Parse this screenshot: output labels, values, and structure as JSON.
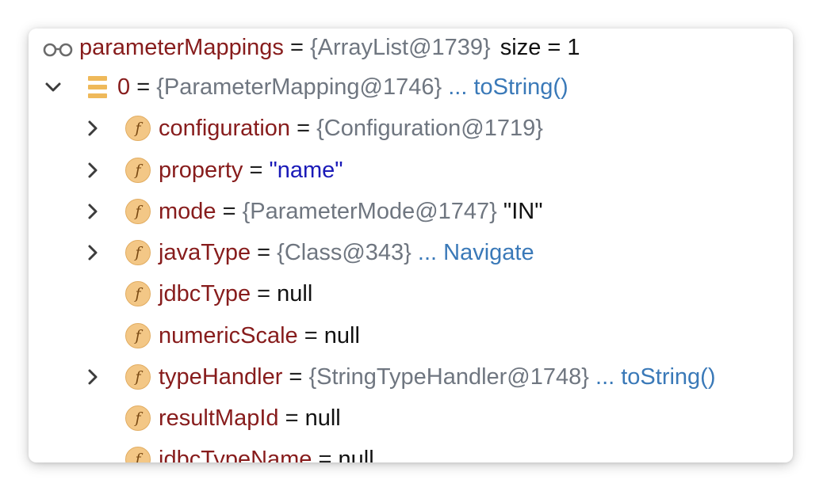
{
  "root": {
    "name": "parameterMappings",
    "eq": " = ",
    "obj": "{ArrayList@1739}",
    "extra": "size = 1"
  },
  "item0": {
    "name": "0",
    "eq": " = ",
    "obj": "{ParameterMapping@1746}",
    "link": "... toString()"
  },
  "fields": [
    {
      "name": "configuration",
      "eq": " = ",
      "obj": "{Configuration@1719}",
      "link": "",
      "str": "",
      "plain": ""
    },
    {
      "name": "property",
      "eq": " = ",
      "obj": "",
      "link": "",
      "str": "\"name\"",
      "plain": ""
    },
    {
      "name": "mode",
      "eq": " = ",
      "obj": "{ParameterMode@1747}",
      "link": "",
      "str": "",
      "plain": " \"IN\""
    },
    {
      "name": "javaType",
      "eq": " = ",
      "obj": "{Class@343}",
      "link": " ... Navigate",
      "str": "",
      "plain": ""
    },
    {
      "name": "jdbcType",
      "eq": " = ",
      "obj": "",
      "link": "",
      "str": "",
      "plain": "null"
    },
    {
      "name": "numericScale",
      "eq": " = ",
      "obj": "",
      "link": "",
      "str": "",
      "plain": "null"
    },
    {
      "name": "typeHandler",
      "eq": " = ",
      "obj": "{StringTypeHandler@1748}",
      "link": " ... toString()",
      "str": "",
      "plain": ""
    },
    {
      "name": "resultMapId",
      "eq": " = ",
      "obj": "",
      "link": "",
      "str": "",
      "plain": "null"
    },
    {
      "name": "jdbcTypeName",
      "eq": " = ",
      "obj": "",
      "link": "",
      "str": "",
      "plain": "null"
    }
  ],
  "icons": {
    "watch": "glasses-icon",
    "list": "list-icon",
    "field": "field-icon",
    "field_letter": "f",
    "expand": "chevron-right-icon",
    "collapse": "chevron-down-icon"
  },
  "colors": {
    "name": "#871c1c",
    "object": "#6f7680",
    "link": "#3a79b8",
    "string": "#1a1ab8",
    "field_icon_bg": "#f3c786"
  }
}
